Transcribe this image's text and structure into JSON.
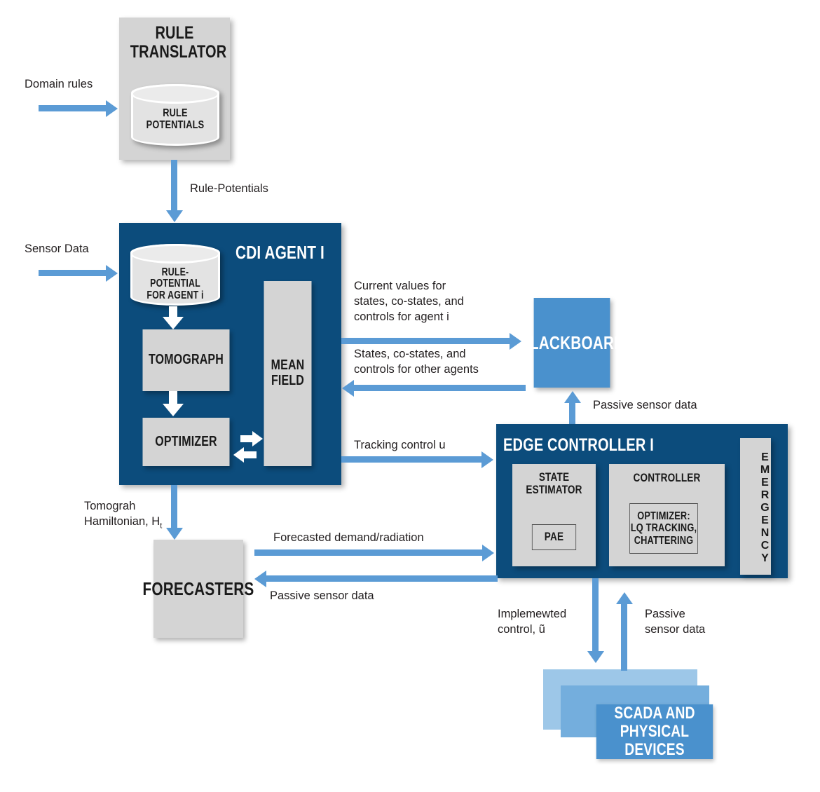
{
  "colors": {
    "dark_navy": "#0c4c7c",
    "light_gray": "#d4d4d4",
    "accent_blue": "#5b9bd5",
    "medium_blue": "#4a91cd",
    "scada_back": "#9dc7e8",
    "scada_mid": "#74aedd",
    "scada_front": "#4a91cd",
    "text_dark": "#231f20",
    "white": "#ffffff"
  },
  "rule_translator": {
    "title": "RULE\nTRANSLATOR",
    "cylinder_label": "RULE\nPOTENTIALS"
  },
  "cdi_agent": {
    "title": "CDI AGENT I",
    "cylinder_label": "RULE-POTENTIAL\nFOR AGENT i",
    "tomograph": "TOMOGRAPH",
    "optimizer": "OPTIMIZER",
    "mean_field": "MEAN\nFIELD"
  },
  "blackboard": {
    "title": "BLACKBOARD"
  },
  "edge_controller": {
    "title": "EDGE CONTROLLER I",
    "state_estimator": "STATE\nESTIMATOR",
    "pae": "PAE",
    "controller": "CONTROLLER",
    "optimizer_detail": "OPTIMIZER:\nLQ TRACKING,\nCHATTERING",
    "emergency": "EMERGENCY"
  },
  "forecasters": {
    "title": "FORECASTERS"
  },
  "scada": {
    "title": "SCADA AND\nPHYSICAL DEVICES"
  },
  "labels": {
    "domain_rules": "Domain rules",
    "sensor_data": "Sensor Data",
    "rule_potentials_flow": "Rule-Potentials",
    "current_values": "Current values for\nstates, co-states, and\ncontrols for agent i",
    "states_other_agents": "States, co-states, and\ncontrols for other agents",
    "tracking_control": "Tracking control u",
    "passive_sensor_blackboard": "Passive sensor data",
    "tomograph_hamiltonian": "Tomograh\nHamiltonian, H",
    "tomograph_hamiltonian_sub": "t",
    "forecasted_demand": "Forecasted demand/radiation",
    "passive_sensor_forecasters": "Passive sensor data",
    "implemented_control": "Implemewted\ncontrol, ũ",
    "passive_sensor_scada": "Passive\nsensor data"
  }
}
